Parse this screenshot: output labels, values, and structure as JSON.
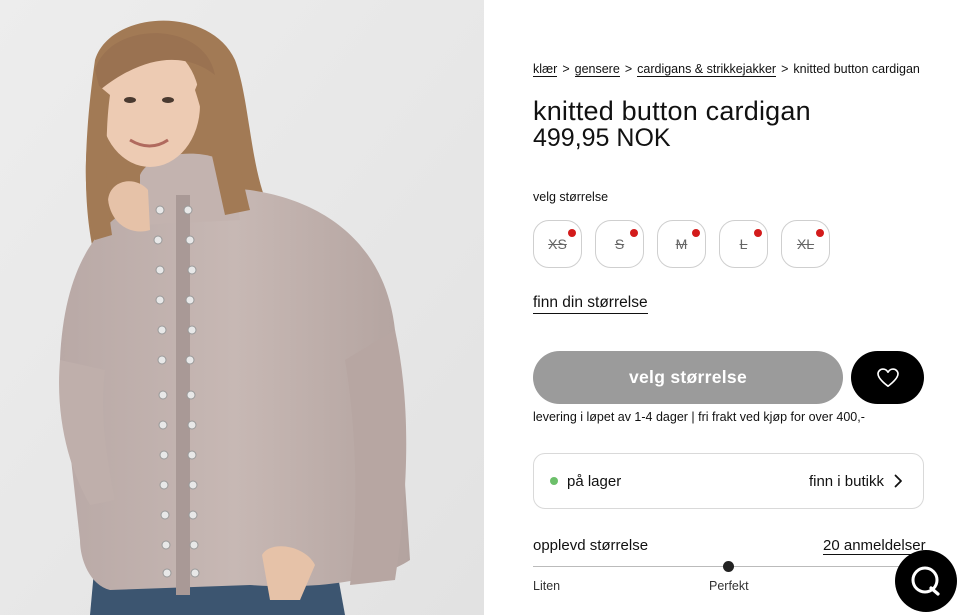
{
  "product_image": {
    "alt": "model wearing knitted button cardigan"
  },
  "breadcrumb": {
    "items": [
      "klær",
      "gensere",
      "cardigans & strikkejakker"
    ],
    "current": "knitted button cardigan",
    "separator": ">"
  },
  "product": {
    "title": "knitted button cardigan",
    "price": "499,95 NOK"
  },
  "size_selector": {
    "label": "velg størrelse",
    "sizes": [
      {
        "label": "XS",
        "available": false
      },
      {
        "label": "S",
        "available": false
      },
      {
        "label": "M",
        "available": false
      },
      {
        "label": "L",
        "available": false
      },
      {
        "label": "XL",
        "available": false
      }
    ],
    "find_size_link": "finn din størrelse"
  },
  "actions": {
    "select_size_button": "velg størrelse",
    "favorite_icon": "heart-icon"
  },
  "delivery_info": "levering i løpet av 1-4 dager | fri frakt ved kjøp for over 400,-",
  "stock": {
    "status": "på lager",
    "status_color": "#6cbf6a",
    "find_in_store": "finn i butikk"
  },
  "fit": {
    "label": "opplevd størrelse",
    "reviews": "20 anmeldelser",
    "scale_min": "Liten",
    "scale_mid": "Perfekt",
    "value": 0.5
  },
  "colors": {
    "unavailable_dot": "#d31b1b",
    "cta_disabled": "#9b9b9b",
    "accent": "#000000"
  },
  "chat": {
    "icon": "chat-bubble-icon"
  }
}
